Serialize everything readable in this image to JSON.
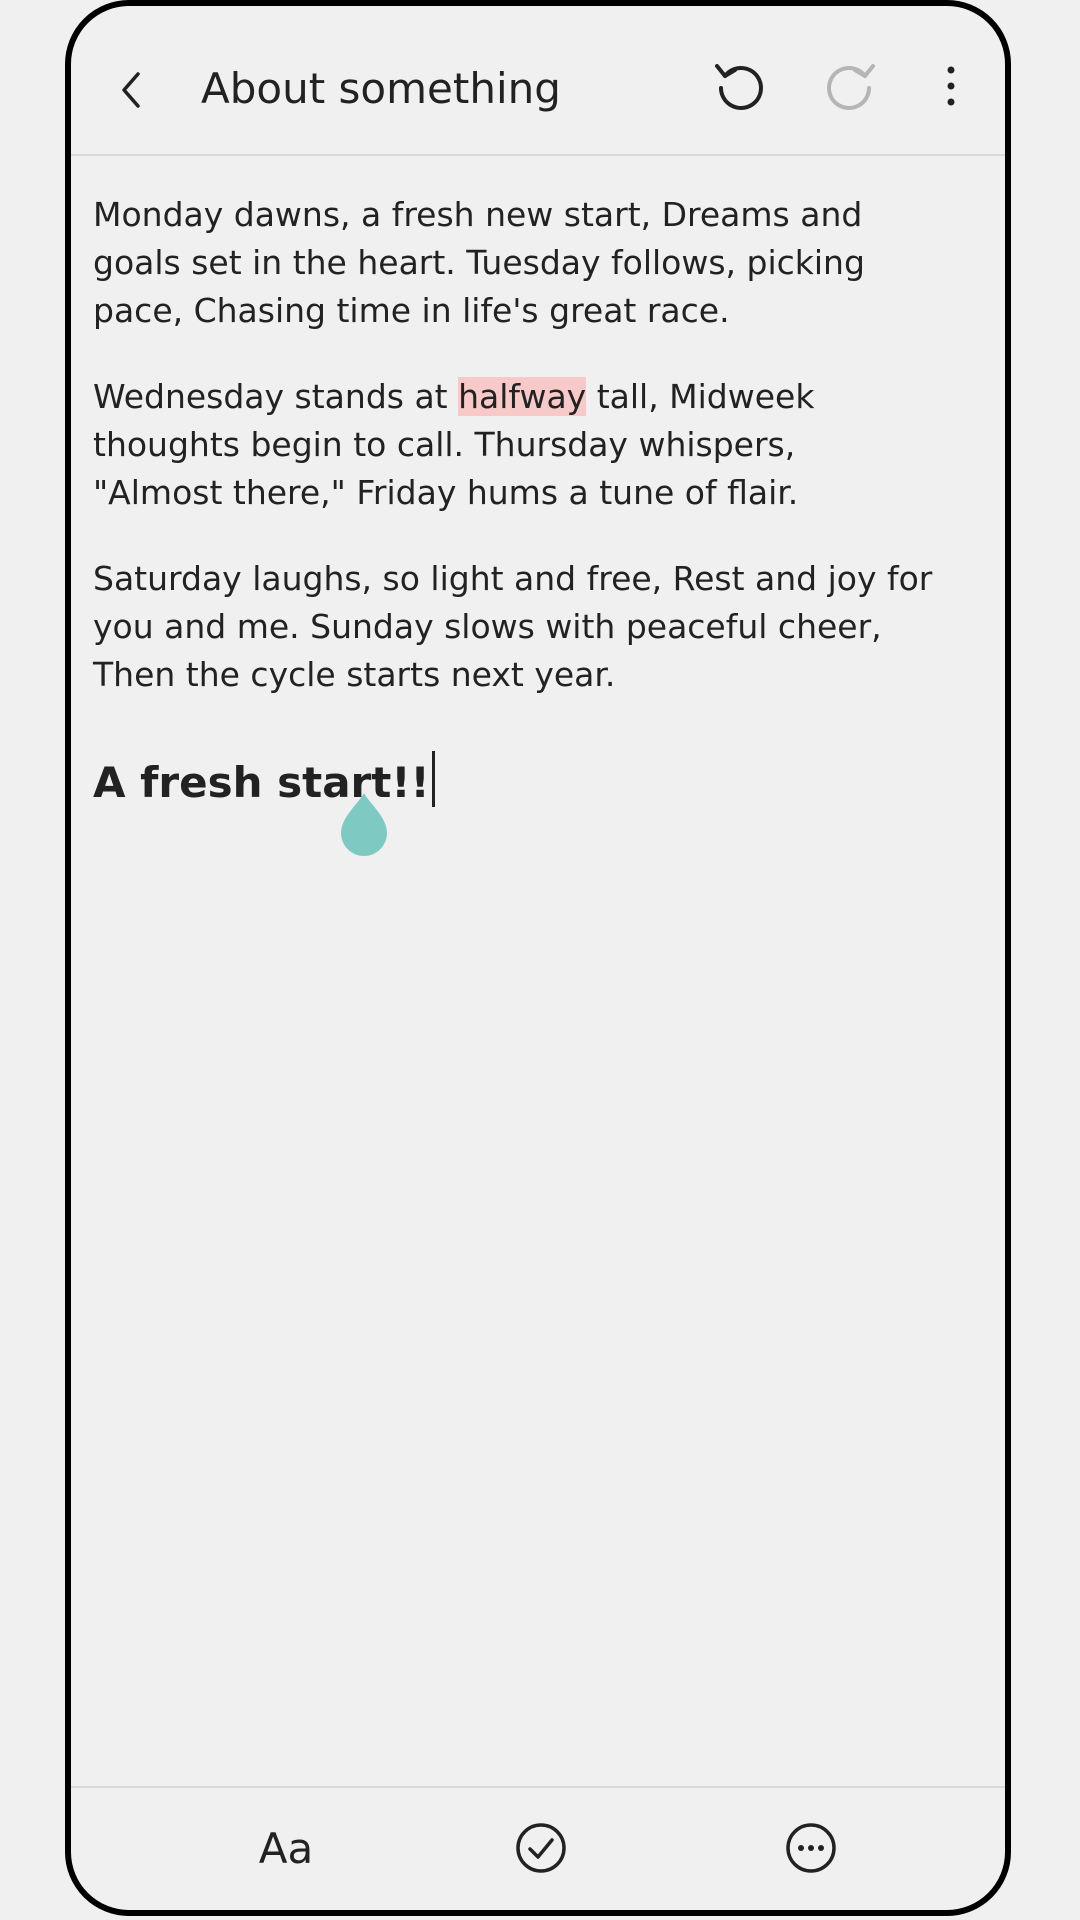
{
  "header": {
    "title": "About something",
    "back_icon": "chevron-left-icon",
    "undo_icon": "undo-icon",
    "redo_icon": "redo-icon",
    "more_icon": "vertical-dots-icon"
  },
  "note": {
    "paragraphs": [
      {
        "text": "Monday dawns, a fresh new start, Dreams and goals set in the heart. Tuesday follows, picking pace, Chasing time in life's great race."
      },
      {
        "before": "Wednesday stands at ",
        "highlight": "halfway",
        "after": " tall, Midweek thoughts begin to call. Thursday whispers, \"Almost there,\" Friday hums a tune of flair."
      },
      {
        "text": "Saturday laughs, so light and free, Rest and joy for you and me. Sunday slows with peaceful cheer, Then the cycle starts next year."
      }
    ],
    "heading": "A fresh start!!",
    "highlight_color": "#f7c9c9",
    "handle_color": "#7ecac3"
  },
  "toolbar": {
    "text_style_label": "Aa",
    "check_icon": "check-circle-icon",
    "more_icon": "more-circle-icon"
  }
}
